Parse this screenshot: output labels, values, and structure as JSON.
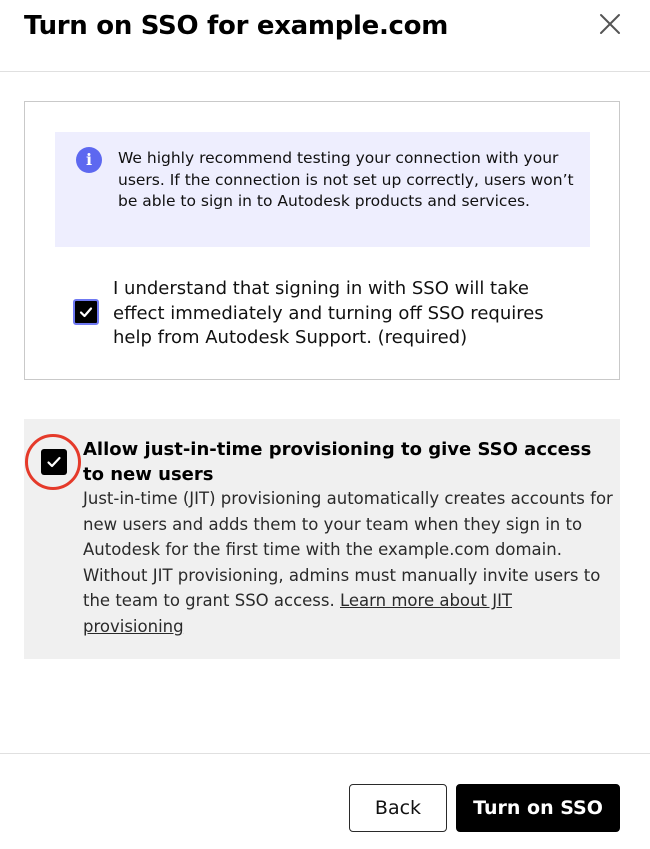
{
  "dialog": {
    "title": "Turn on SSO for example.com",
    "close_icon": "close-icon"
  },
  "info_banner": {
    "icon": "info-icon",
    "icon_glyph": "i",
    "text": "We highly recommend testing your connection with your users. If the connection is not set up correctly, users won’t be able to sign in to Autodesk products and services."
  },
  "acknowledge": {
    "checked": true,
    "label": "I understand that signing in with SSO will take effect immediately and turning off SSO requires help from Autodesk Support. (required)"
  },
  "jit": {
    "checked": true,
    "title": "Allow just-in-time provisioning to give SSO access to new users",
    "description": "Just-in-time (JIT) provisioning automatically creates accounts for new users and adds them to your team when they sign in to Autodesk for the first time with the example.com domain. Without JIT provisioning, admins must manually invite users to the team to grant SSO access.",
    "link_label": "Learn more about JIT provisioning"
  },
  "footer": {
    "back_label": "Back",
    "primary_label": "Turn on SSO"
  },
  "colors": {
    "primary_button": "#000000",
    "info_background": "#eeeefe",
    "info_icon": "#5d68f0",
    "highlight_ring": "#e53a2a",
    "jit_background": "#f0f0f0"
  }
}
